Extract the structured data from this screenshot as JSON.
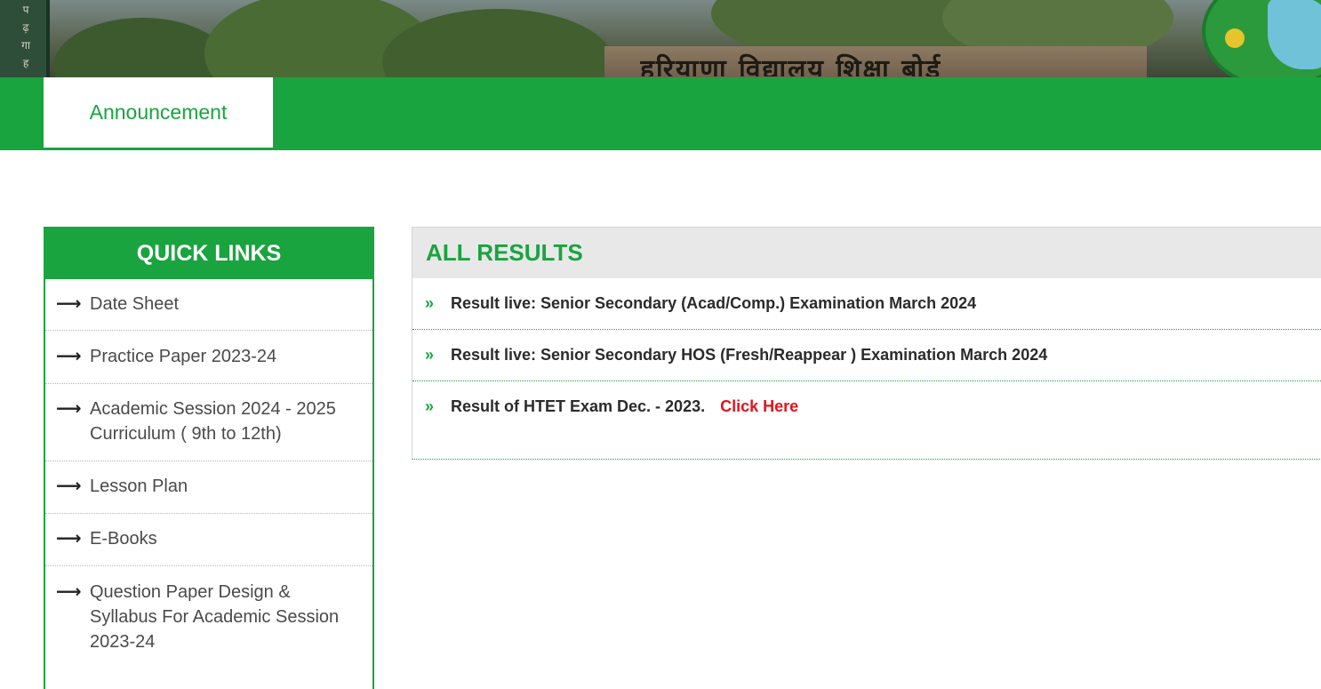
{
  "banner": {
    "building_text": "हरियाणा विद्यालय शिक्षा बोर्ड",
    "left_sign_text": [
      "प",
      "ढ़",
      "गा",
      "ह"
    ]
  },
  "nav": {
    "tab_label": "Announcement"
  },
  "quick_links": {
    "title": "QUICK LINKS",
    "items": [
      {
        "label_lines": [
          "Date Sheet"
        ]
      },
      {
        "label_lines": [
          "Practice Paper 2023-24"
        ]
      },
      {
        "label_lines": [
          "Academic Session 2024 - 2025",
          "Curriculum ( 9th to 12th)"
        ]
      },
      {
        "label_lines": [
          "Lesson Plan"
        ]
      },
      {
        "label_lines": [
          "E-Books"
        ]
      },
      {
        "label_lines": [
          "Question Paper Design &",
          "Syllabus For Academic Session",
          "2023-24"
        ]
      }
    ]
  },
  "results": {
    "title": "ALL RESULTS",
    "items": [
      {
        "text": "Result live:  Senior Secondary (Acad/Comp.) Examination March 2024",
        "link": ""
      },
      {
        "text": "Result live: Senior Secondary HOS (Fresh/Reappear ) Examination March 2024",
        "link": ""
      },
      {
        "text": "Result of HTET Exam Dec. - 2023.",
        "link": "Click Here"
      }
    ]
  },
  "colors": {
    "brand_green": "#19a43f",
    "link_red": "#e0141a",
    "header_gray": "#e8e8e8"
  },
  "icons": {
    "quick_link_bullet": "right-arrow-icon",
    "result_bullet": "double-chevron-right-icon"
  }
}
